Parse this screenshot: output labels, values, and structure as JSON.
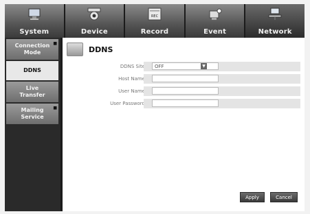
{
  "tabs": [
    {
      "label": "System",
      "icon": "system-monitor-icon"
    },
    {
      "label": "Device",
      "icon": "camera-icon"
    },
    {
      "label": "Record",
      "icon": "rec-icon",
      "badge": "REC"
    },
    {
      "label": "Event",
      "icon": "event-icon"
    },
    {
      "label": "Network",
      "icon": "network-icon"
    }
  ],
  "sidebar": {
    "items": [
      {
        "label_line1": "Connection",
        "label_line2": "Mode"
      },
      {
        "label_line1": "DDNS",
        "label_line2": ""
      },
      {
        "label_line1": "Live",
        "label_line2": "Transfer"
      },
      {
        "label_line1": "Mailing",
        "label_line2": "Service"
      }
    ]
  },
  "page": {
    "title": "DDNS"
  },
  "form": {
    "ddns_site_label": "DDNS Site",
    "ddns_site_value": "OFF",
    "host_name_label": "Host Name",
    "host_name_value": "",
    "user_name_label": "User Name",
    "user_name_value": "",
    "user_password_label": "User Password",
    "user_password_value": ""
  },
  "buttons": {
    "apply": "Apply",
    "cancel": "Cancel"
  }
}
